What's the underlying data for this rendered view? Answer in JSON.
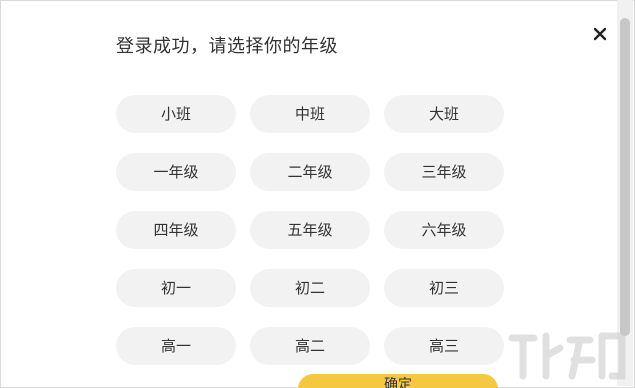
{
  "dialog": {
    "title": "登录成功，请选择你的年级",
    "close_icon": "close-icon",
    "grades": [
      "小班",
      "中班",
      "大班",
      "一年级",
      "二年级",
      "三年级",
      "四年级",
      "五年级",
      "六年级",
      "初一",
      "初二",
      "初三",
      "高一",
      "高二",
      "高三"
    ],
    "confirm_label": "确定"
  },
  "colors": {
    "grade_button_bg": "#f2f2f2",
    "confirm_button_bg": "#f5c842",
    "text": "#333333"
  }
}
